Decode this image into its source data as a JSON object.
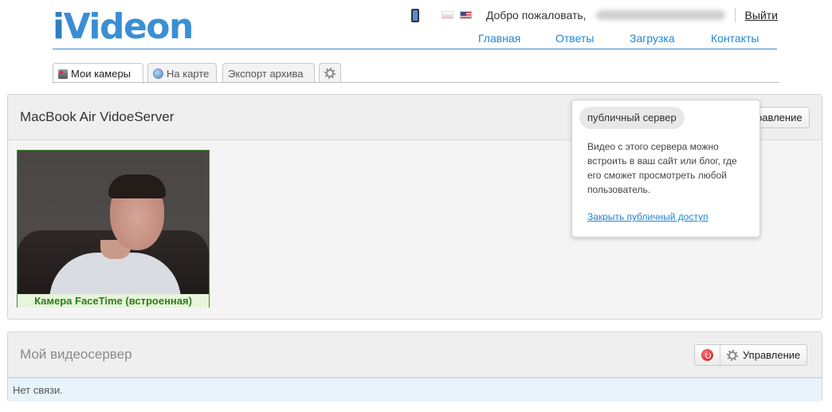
{
  "header": {
    "logo_prefix": "i",
    "logo_rest": "Videon",
    "welcome_text": "Добро пожаловать,",
    "logout_label": "Выйти",
    "nav": [
      {
        "label": "Главная"
      },
      {
        "label": "Ответы"
      },
      {
        "label": "Загрузка"
      },
      {
        "label": "Контакты"
      }
    ]
  },
  "tabs": [
    {
      "label": "Мои камеры",
      "icon": "camera-icon",
      "active": true
    },
    {
      "label": "На карте",
      "icon": "globe-icon"
    },
    {
      "label": "Экспорт архива"
    },
    {
      "label": "",
      "icon": "gear-icon"
    }
  ],
  "server_1": {
    "title": "MacBook Air VidoeServer",
    "manage_button_label": "равление",
    "camera_label": "Камера FaceTime (встроенная)"
  },
  "popover": {
    "pill_label": "публичный сервер",
    "description": "Видео с этого сервера можно встроить в ваш сайт или блог, где его сможет просмотреть любой пользователь.",
    "link_label": "Закрыть публичный доступ"
  },
  "server_2": {
    "title": "Мой видеосервер",
    "manage_button_label": "Управление",
    "status_text": "Нет связи."
  },
  "colors": {
    "accent": "#1f86d6",
    "camera_border": "#3c8c2c",
    "camera_label_text": "#2e7d1f",
    "status_bg": "#e9f3fb"
  }
}
